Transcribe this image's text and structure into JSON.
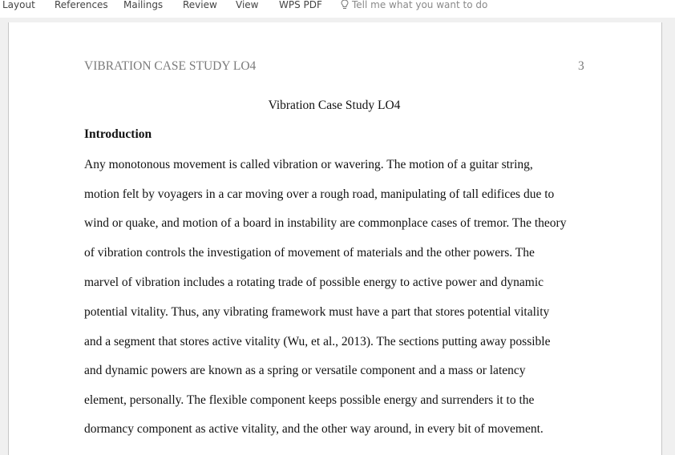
{
  "ribbon": {
    "tabs": [
      {
        "label": "Layout"
      },
      {
        "label": "References"
      },
      {
        "label": "Mailings"
      },
      {
        "label": "Review"
      },
      {
        "label": "View"
      },
      {
        "label": "WPS PDF"
      }
    ],
    "tell_me": {
      "icon": "lightbulb-icon",
      "placeholder": "Tell me what you want to do"
    }
  },
  "document": {
    "header": {
      "running_head": "VIBRATION CASE STUDY LO4",
      "page_number": "3"
    },
    "title": "Vibration Case Study LO4",
    "section_heading": "Introduction",
    "body_lines": [
      "Any monotonous movement is called vibration or wavering. The motion of a guitar string,",
      "motion felt by voyagers in a car moving over a rough road, manipulating of tall edifices due to",
      "wind or quake, and motion of a board in instability are commonplace cases of tremor. The theory",
      "of vibration controls the investigation of movement of materials and the other powers. The",
      "marvel of vibration includes a rotating trade of possible energy to active power and dynamic",
      "potential vitality. Thus, any vibrating framework must have a part that stores potential vitality",
      "and a segment that stores active vitality (Wu, et al., 2013). The sections putting away possible",
      "and dynamic powers are known as a spring or versatile component and a mass or latency",
      "element, personally. The flexible component keeps possible energy and surrenders it to the",
      "dormancy component as active vitality, and the other way around, in every bit of movement."
    ]
  }
}
